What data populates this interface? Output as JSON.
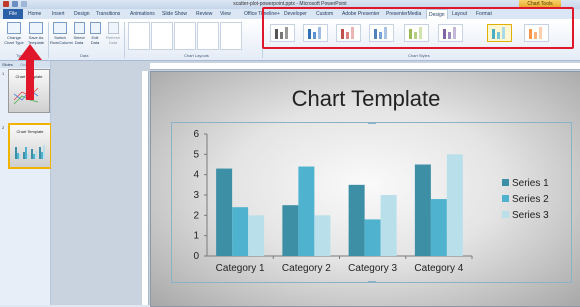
{
  "window": {
    "title": "scatter-plot-powerpoint.pptx - Microsoft PowerPoint",
    "context_tab": "Chart Tools"
  },
  "tabs": {
    "file": "File",
    "items": [
      "Home",
      "Insert",
      "Design",
      "Transitions",
      "Animations",
      "Slide Show",
      "Review",
      "View",
      "Office Timeline+",
      "Developer",
      "Custom",
      "Adobe Presenter",
      "PresenterMedia",
      "Design",
      "Layout",
      "Format"
    ],
    "active_index": 13
  },
  "ribbon": {
    "change_chart_type": "Change Chart Type",
    "save_as_template": "Save As Template",
    "type_group": "Type",
    "switch_row_column": "Switch Row/Column",
    "select_data": "Select Data",
    "edit_data": "Edit Data",
    "refresh_data": "Refresh Data",
    "data_group": "Data",
    "chart_layouts_group": "Chart Layouts",
    "chart_styles_group": "Chart Styles"
  },
  "pane": {
    "tab_slides": "Slides",
    "tab_outline": "Outline",
    "slide1_num": "1",
    "slide2_num": "2",
    "slide1_title": "Chart Template",
    "slide2_title": "Chart Template"
  },
  "colors": {
    "series1": "#3d8fa6",
    "series2": "#4fb3cf",
    "series3": "#b9dfeb",
    "highlight": "#e0162b"
  },
  "slide": {
    "title": "Chart Template"
  },
  "chart_data": {
    "type": "bar",
    "categories": [
      "Category 1",
      "Category 2",
      "Category 3",
      "Category 4"
    ],
    "series": [
      {
        "name": "Series 1",
        "values": [
          4.3,
          2.5,
          3.5,
          4.5
        ]
      },
      {
        "name": "Series 2",
        "values": [
          2.4,
          4.4,
          1.8,
          2.8
        ]
      },
      {
        "name": "Series 3",
        "values": [
          2.0,
          2.0,
          3.0,
          5.0
        ]
      }
    ],
    "ylim": [
      0,
      6
    ],
    "yticks": [
      "0",
      "1",
      "2",
      "3",
      "4",
      "5",
      "6"
    ],
    "grid": false,
    "legend": "right"
  }
}
